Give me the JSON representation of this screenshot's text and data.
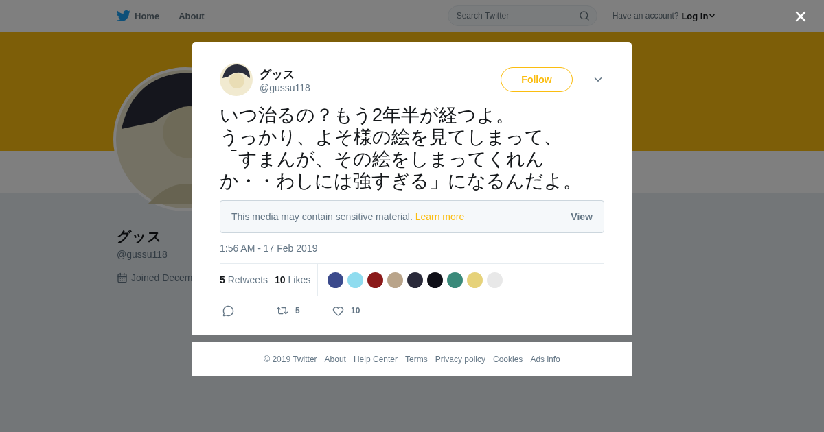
{
  "nav": {
    "items": [
      {
        "kind": "home",
        "label": "Home"
      },
      {
        "kind": "plain",
        "label": "About"
      }
    ],
    "search": {
      "placeholder": "Search Twitter"
    },
    "account_prompt": "Have an account?",
    "login": "Log in"
  },
  "profile": {
    "name": "グッス",
    "handle": "@gussu118",
    "joined": "Joined Decem"
  },
  "tweet": {
    "author": {
      "name": "グッス",
      "handle": "@gussu118"
    },
    "follow": "Follow",
    "paragraphs": [
      "いつ治るの？もう2年半が経つよ。",
      "うっかり、よそ様の絵を見てしまって、「すまんが、その絵をしまってくれんか・・わしには強すぎる」になるんだよ。"
    ],
    "sensitive": {
      "text": "This media may contain sensitive material.",
      "link": "Learn more",
      "button": "View"
    },
    "timestamp": "1:56 AM - 17 Feb 2019",
    "stats": [
      {
        "count": "5",
        "label": "Retweets"
      },
      {
        "count": "10",
        "label": "Likes"
      }
    ],
    "likers": [
      {
        "color": "#3b4a8c"
      },
      {
        "color": "#8fdcef"
      },
      {
        "color": "#8b1a1a"
      },
      {
        "color": "#b9a48a"
      },
      {
        "color": "#2a2a3a"
      },
      {
        "color": "#101018"
      },
      {
        "color": "#3a8a7a"
      },
      {
        "color": "#e6d27a"
      },
      {
        "color": "#e8e8e8"
      }
    ],
    "actions": [
      {
        "kind": "reply"
      },
      {
        "kind": "retweet",
        "count": "5"
      },
      {
        "kind": "like",
        "count": "10"
      }
    ]
  },
  "footer": [
    "© 2019 Twitter",
    "About",
    "Help Center",
    "Terms",
    "Privacy policy",
    "Cookies",
    "Ads info"
  ]
}
